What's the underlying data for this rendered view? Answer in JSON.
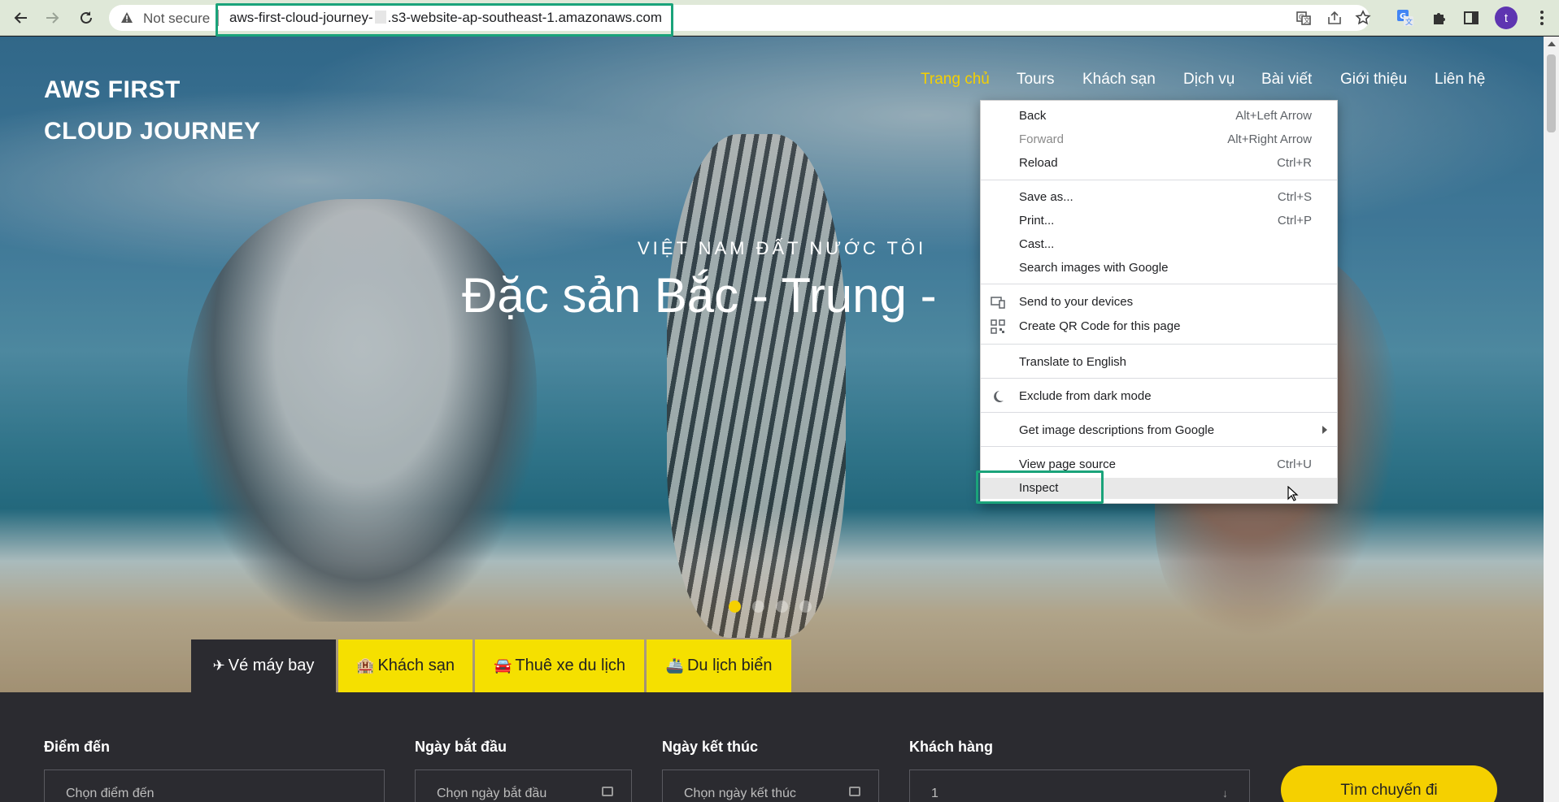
{
  "browser": {
    "security_label": "Not secure",
    "url_prefix": "aws-first-cloud-journey-",
    "url_suffix": ".s3-website-ap-southeast-1.amazonaws.com",
    "profile_initial": "t",
    "icons": [
      "back-arrow-icon",
      "forward-arrow-icon",
      "reload-icon",
      "warning-icon",
      "translate-icon",
      "share-icon",
      "bookmark-star-icon",
      "google-translate-extension-icon",
      "extensions-puzzle-icon",
      "side-panel-icon",
      "kebab-menu-icon"
    ],
    "highlight_color": "#1aa37a"
  },
  "site": {
    "brand_line1": "AWS FIRST",
    "brand_line2": "CLOUD JOURNEY",
    "nav": [
      {
        "label": "Trang chủ",
        "active": true
      },
      {
        "label": "Tours"
      },
      {
        "label": "Khách sạn"
      },
      {
        "label": "Dịch vụ"
      },
      {
        "label": "Bài viết"
      },
      {
        "label": "Giới thiệu"
      },
      {
        "label": "Liên hệ"
      }
    ],
    "hero_subtitle": "VIỆT NAM ĐẤT NƯỚC TÔI",
    "hero_title": "Đặc sản Bắc - Trung -",
    "accent_color": "#f5d000",
    "tabs": [
      {
        "icon": "plane-icon",
        "glyph": "✈",
        "label": "Vé máy bay",
        "active": true
      },
      {
        "icon": "hotel-icon",
        "glyph": "🏨",
        "label": "Khách sạn"
      },
      {
        "icon": "car-icon",
        "glyph": "🚘",
        "label": "Thuê xe du lịch"
      },
      {
        "icon": "ship-icon",
        "glyph": "🚢",
        "label": "Du lịch biển"
      }
    ],
    "search": {
      "destination_label": "Điểm đến",
      "destination_placeholder": "Chọn điểm đến",
      "start_label": "Ngày bắt đầu",
      "start_placeholder": "Chọn ngày bắt đầu",
      "end_label": "Ngày kết thúc",
      "end_placeholder": "Chọn ngày kết thúc",
      "guests_label": "Khách hàng",
      "guests_value": "1",
      "button_label": "Tìm chuyến đi"
    }
  },
  "context_menu": {
    "items": [
      {
        "label": "Back",
        "shortcut": "Alt+Left Arrow"
      },
      {
        "label": "Forward",
        "shortcut": "Alt+Right Arrow",
        "disabled": true
      },
      {
        "label": "Reload",
        "shortcut": "Ctrl+R"
      },
      {
        "label": "Save as...",
        "shortcut": "Ctrl+S"
      },
      {
        "label": "Print...",
        "shortcut": "Ctrl+P"
      },
      {
        "label": "Cast..."
      },
      {
        "label": "Search images with Google"
      },
      {
        "label": "Send to your devices",
        "icon": "devices-icon"
      },
      {
        "label": "Create QR Code for this page",
        "icon": "qr-code-icon"
      },
      {
        "label": "Translate to English"
      },
      {
        "label": "Exclude from dark mode",
        "icon": "dark-mode-icon"
      },
      {
        "label": "Get image descriptions from Google",
        "submenu": true
      },
      {
        "label": "View page source",
        "shortcut": "Ctrl+U"
      },
      {
        "label": "Inspect",
        "hovered": true
      }
    ]
  }
}
